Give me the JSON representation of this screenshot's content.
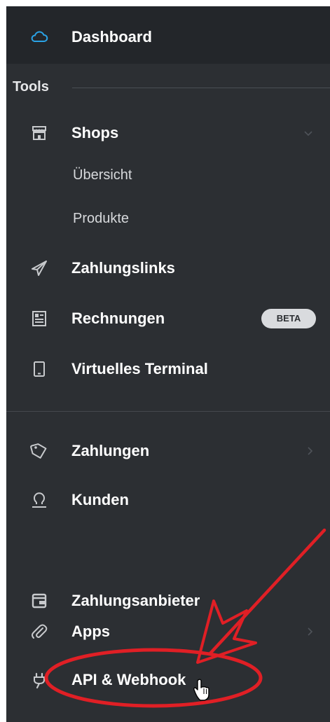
{
  "sidebar": {
    "dashboard": {
      "label": "Dashboard",
      "icon": "cloud-icon"
    },
    "section_title": "Tools",
    "shops": {
      "label": "Shops",
      "icon": "shop-icon",
      "sub_items": [
        "Übersicht",
        "Produkte"
      ]
    },
    "zahlungslinks": {
      "label": "Zahlungslinks",
      "icon": "paper-plane-icon"
    },
    "rechnungen": {
      "label": "Rechnungen",
      "icon": "invoice-icon",
      "badge": "BETA"
    },
    "terminal": {
      "label": "Virtuelles Terminal",
      "icon": "mobile-icon"
    },
    "zahlungen": {
      "label": "Zahlungen",
      "icon": "tag-icon"
    },
    "kunden": {
      "label": "Kunden",
      "icon": "user-icon"
    },
    "zahlungsanbieter": {
      "label": "Zahlungsanbieter",
      "icon": "wallet-icon"
    },
    "apps": {
      "label": "Apps",
      "icon": "paperclip-icon"
    },
    "api": {
      "label": "API & Webhook",
      "icon": "plug-icon"
    }
  },
  "colors": {
    "sidebar_bg": "#2c2f33",
    "active_bg": "#23262a",
    "accent_blue": "#2aa3e6",
    "annotation_red": "#e01f25"
  }
}
